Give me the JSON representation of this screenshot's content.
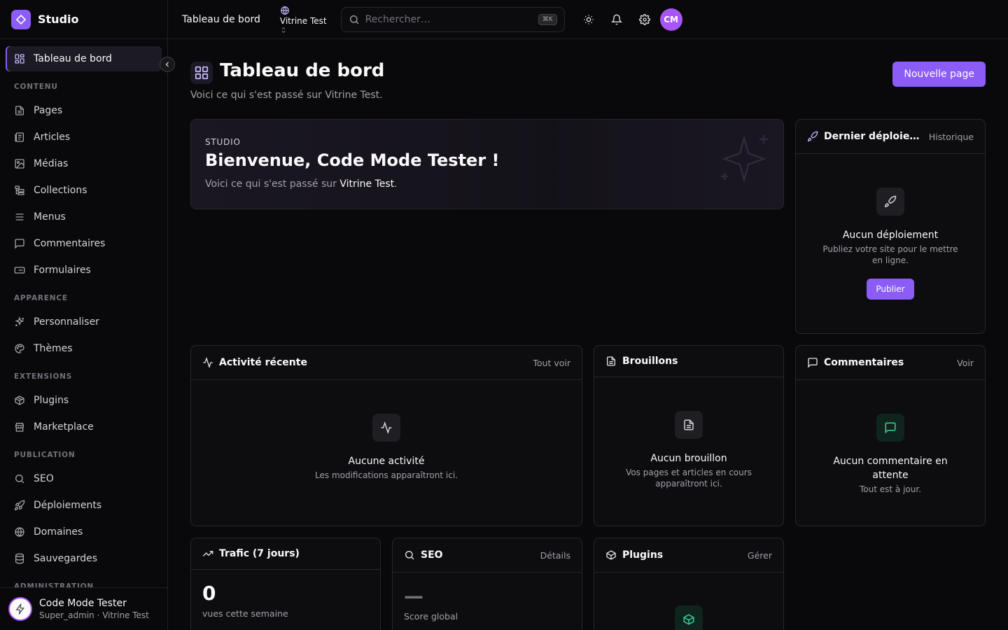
{
  "app": {
    "name": "Studio"
  },
  "topbar": {
    "breadcrumb": "Tableau de bord",
    "site_name": "Vitrine Test",
    "search_placeholder": "Rechercher…",
    "search_shortcut": "⌘K",
    "avatar_initials": "CM"
  },
  "sidebar": {
    "active": {
      "label": "Tableau de bord",
      "icon": "dashboard-grid-icon"
    },
    "sections": [
      {
        "title": "CONTENU",
        "items": [
          {
            "label": "Pages",
            "icon": "file-icon"
          },
          {
            "label": "Articles",
            "icon": "newspaper-icon"
          },
          {
            "label": "Médias",
            "icon": "image-icon"
          },
          {
            "label": "Collections",
            "icon": "collections-icon"
          },
          {
            "label": "Menus",
            "icon": "menu-icon"
          },
          {
            "label": "Commentaires",
            "icon": "comment-icon"
          },
          {
            "label": "Formulaires",
            "icon": "form-icon"
          }
        ]
      },
      {
        "title": "APPARENCE",
        "items": [
          {
            "label": "Personnaliser",
            "icon": "sparkles-icon"
          },
          {
            "label": "Thèmes",
            "icon": "palette-icon"
          }
        ]
      },
      {
        "title": "EXTENSIONS",
        "items": [
          {
            "label": "Plugins",
            "icon": "package-icon"
          },
          {
            "label": "Marketplace",
            "icon": "store-icon"
          }
        ]
      },
      {
        "title": "PUBLICATION",
        "items": [
          {
            "label": "SEO",
            "icon": "search-icon"
          },
          {
            "label": "Déploiements",
            "icon": "rocket-icon"
          },
          {
            "label": "Domaines",
            "icon": "globe-icon"
          },
          {
            "label": "Sauvegardes",
            "icon": "database-icon"
          }
        ]
      },
      {
        "title": "ADMINISTRATION",
        "items": []
      }
    ],
    "user": {
      "name": "Code Mode Tester",
      "role": "Super_admin · Vitrine Test"
    }
  },
  "page": {
    "title": "Tableau de bord",
    "subtitle": "Voici ce qui s'est passé sur Vitrine Test.",
    "new_page_button": "Nouvelle page"
  },
  "welcome": {
    "label": "STUDIO",
    "title": "Bienvenue, Code Mode Tester !",
    "subtitle_prefix": "Voici ce qui s'est passé sur ",
    "subtitle_site": "Vitrine Test",
    "subtitle_suffix": "."
  },
  "deploy": {
    "title": "Dernier déploiement",
    "link": "Historique",
    "empty_title": "Aucun déploiement",
    "empty_desc": "Publiez votre site pour le mettre en ligne.",
    "button": "Publier"
  },
  "activity": {
    "title": "Activité récente",
    "link": "Tout voir",
    "empty_title": "Aucune activité",
    "empty_desc": "Les modifications apparaîtront ici."
  },
  "drafts": {
    "title": "Brouillons",
    "empty_title": "Aucun brouillon",
    "empty_desc": "Vos pages et articles en cours apparaîtront ici."
  },
  "comments": {
    "title": "Commentaires",
    "link": "Voir",
    "empty_title": "Aucun commentaire en attente",
    "empty_desc": "Tout est à jour."
  },
  "traffic": {
    "title": "Trafic (7 jours)",
    "value": "0",
    "caption": "vues cette semaine"
  },
  "seo": {
    "title": "SEO",
    "link": "Détails",
    "value": "—",
    "caption": "Score global"
  },
  "plugins": {
    "title": "Plugins",
    "link": "Gérer"
  },
  "colors": {
    "accent": "#8b5cf6",
    "background": "#09090b",
    "card": "#0d0d10",
    "border": "#27272a",
    "success": "#34d399"
  }
}
